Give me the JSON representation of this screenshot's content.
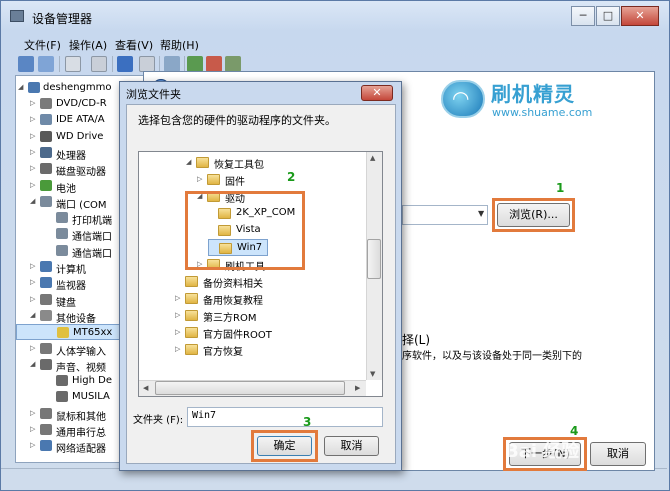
{
  "window": {
    "title": "设备管理器",
    "controls": [
      "─",
      "□",
      "✕"
    ]
  },
  "menu": [
    "文件(F)",
    "操作(A)",
    "查看(V)",
    "帮助(H)"
  ],
  "tree": {
    "root": "deshengmmo",
    "items": [
      {
        "label": "DVD/CD-R",
        "level": 1,
        "arrow": "▷",
        "color": "#7a7a7a"
      },
      {
        "label": "IDE ATA/A",
        "level": 1,
        "arrow": "▷",
        "color": "#6f8aa8"
      },
      {
        "label": "WD Drive",
        "level": 1,
        "arrow": "▷",
        "color": "#5a5a5a"
      },
      {
        "label": "处理器",
        "level": 1,
        "arrow": "▷",
        "color": "#4d6a8c"
      },
      {
        "label": "磁盘驱动器",
        "level": 1,
        "arrow": "▷",
        "color": "#6b6b6b"
      },
      {
        "label": "电池",
        "level": 1,
        "arrow": "▷",
        "color": "#4a9a3a"
      },
      {
        "label": "端口 (COM",
        "level": 1,
        "arrow": "◢",
        "color": "#7b8b9c"
      },
      {
        "label": "打印机端",
        "level": 2,
        "arrow": "",
        "color": "#7b8b9c"
      },
      {
        "label": "通信端口",
        "level": 2,
        "arrow": "",
        "color": "#7b8b9c"
      },
      {
        "label": "通信端口",
        "level": 2,
        "arrow": "",
        "color": "#7b8b9c"
      },
      {
        "label": "计算机",
        "level": 1,
        "arrow": "▷",
        "color": "#4a78b0"
      },
      {
        "label": "监视器",
        "level": 1,
        "arrow": "▷",
        "color": "#4a78b0"
      },
      {
        "label": "键盘",
        "level": 1,
        "arrow": "▷",
        "color": "#777777"
      },
      {
        "label": "其他设备",
        "level": 1,
        "arrow": "◢",
        "color": "#8a8a8a"
      },
      {
        "label": "MT65xx",
        "level": 2,
        "arrow": "",
        "color": "#e0c040",
        "selected": true
      },
      {
        "label": "人体学输入",
        "level": 1,
        "arrow": "▷",
        "color": "#777777"
      },
      {
        "label": "声音、视频",
        "level": 1,
        "arrow": "◢",
        "color": "#6a6a6a"
      },
      {
        "label": "High De",
        "level": 2,
        "arrow": "",
        "color": "#6a6a6a"
      },
      {
        "label": "MUSILA",
        "level": 2,
        "arrow": "",
        "color": "#6a6a6a"
      },
      {
        "label": "鼠标和其他",
        "level": 1,
        "arrow": "▷",
        "color": "#777777"
      },
      {
        "label": "通用串行总",
        "level": 1,
        "arrow": "▷",
        "color": "#777777"
      },
      {
        "label": "网络适配器",
        "level": 1,
        "arrow": "▷",
        "color": "#4a78b0"
      }
    ]
  },
  "wizard": {
    "logo_text": "刷机精灵",
    "logo_url": "www.shuame.com",
    "browse_button": "浏览(R)...",
    "option_label": "择(L)",
    "option_desc": "序软件，以及与该设备处于同一类别下的",
    "next_button": "下一步(N)",
    "cancel_button": "取消"
  },
  "dialog": {
    "title": "浏览文件夹",
    "close_label": "✕",
    "description": "选择包含您的硬件的驱动程序的文件夹。",
    "folders": [
      {
        "label": "恢复工具包",
        "indent": 1,
        "arrow": "◢"
      },
      {
        "label": "固件",
        "indent": 2,
        "arrow": "▷"
      },
      {
        "label": "驱动",
        "indent": 2,
        "arrow": "◢"
      },
      {
        "label": "2K_XP_COM",
        "indent": 3,
        "arrow": ""
      },
      {
        "label": "Vista",
        "indent": 3,
        "arrow": ""
      },
      {
        "label": "Win7",
        "indent": 3,
        "arrow": "",
        "selected": true
      },
      {
        "label": "刷机工具",
        "indent": 2,
        "arrow": "▷"
      },
      {
        "label": "备份资料相关",
        "indent": 0,
        "arrow": ""
      },
      {
        "label": "备用恢复教程",
        "indent": 0,
        "arrow": "▷"
      },
      {
        "label": "第三方ROM",
        "indent": 0,
        "arrow": "▷"
      },
      {
        "label": "官方固件ROOT",
        "indent": 0,
        "arrow": "▷"
      },
      {
        "label": "官方恢复",
        "indent": 0,
        "arrow": "▷"
      }
    ],
    "folder_label": "文件夹 (F):",
    "folder_value": "Win7",
    "ok_button": "确定",
    "cancel_button": "取消"
  },
  "annotations": [
    "1",
    "2",
    "3",
    "4"
  ],
  "watermark": "Bai 经验"
}
